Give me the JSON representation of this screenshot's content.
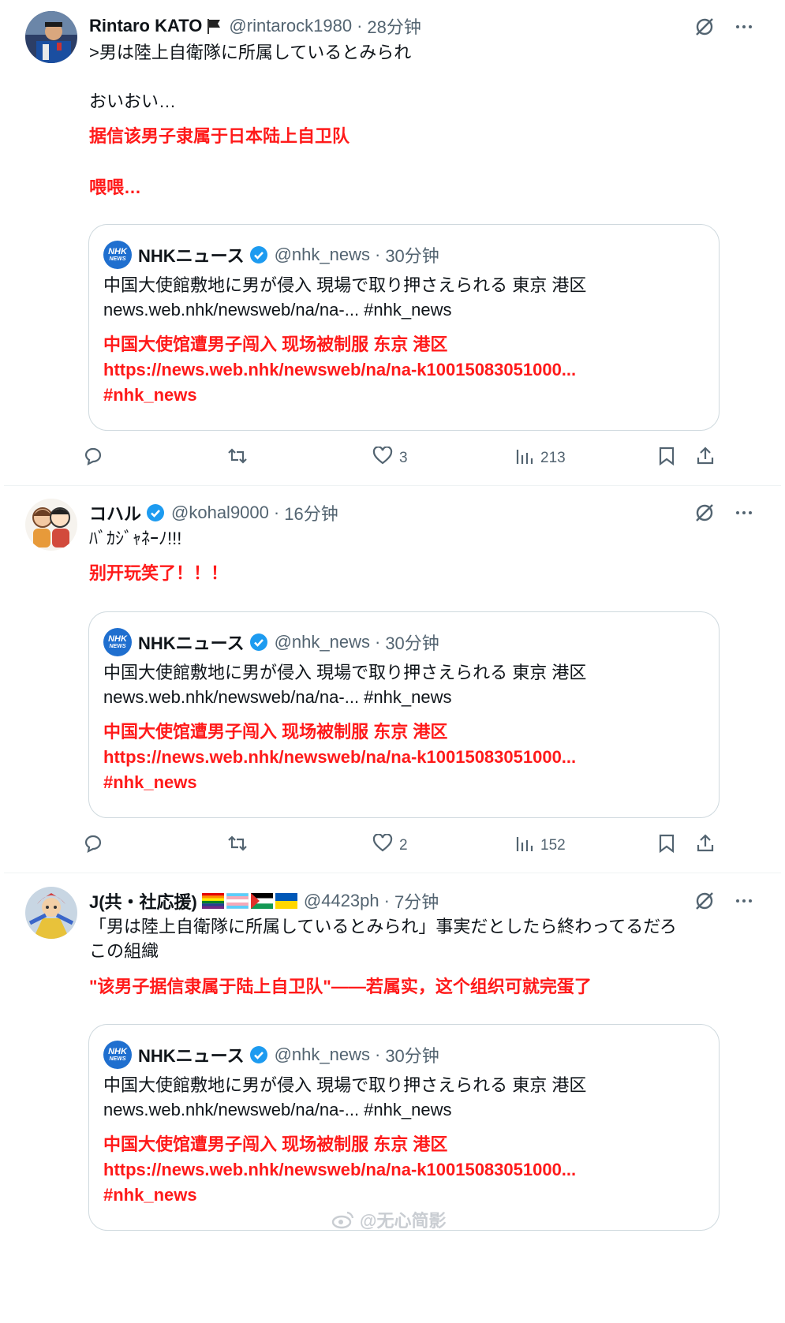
{
  "posts": [
    {
      "name": "Rintaro KATO",
      "name_flag": "🏴",
      "handle": "@rintarock1980",
      "time": "28分钟",
      "lines": [
        ">男は陸上自衛隊に所属しているとみられ",
        "おいおい…"
      ],
      "translations": [
        "据信该男子隶属于日本陆上自卫队",
        "喂喂…"
      ],
      "stats": {
        "replies": "",
        "reposts": "",
        "likes": "3",
        "views": "213"
      }
    },
    {
      "name": "コハル",
      "handle": "@kohal9000",
      "time": "16分钟",
      "lines": [
        "ﾊﾞｶｼﾞｬﾈｰﾉ!!!"
      ],
      "translations": [
        "别开玩笑了！！！"
      ],
      "stats": {
        "replies": "",
        "reposts": "",
        "likes": "2",
        "views": "152"
      }
    },
    {
      "name": "J(共・社応援)",
      "handle": "@4423ph",
      "time": "7分钟",
      "lines": [
        "「男は陸上自衛隊に所属しているとみられ」事実だとしたら終わってるだろ",
        "この組織"
      ],
      "translations": [
        "\"该男子据信隶属于陆上自卫队\"——若属实，这个组织可就完蛋了"
      ]
    }
  ],
  "quote": {
    "name": "NHKニュース",
    "handle": "@nhk_news",
    "time": "30分钟",
    "line1": "中国大使館敷地に男が侵入 現場で取り押さえられる 東京 港区",
    "line2": "news.web.nhk/newsweb/na/na-... #nhk_news",
    "tr1": "中国大使馆遭男子闯入 现场被制服 东京 港区",
    "tr2": "https://news.web.nhk/newsweb/na/na-k10015083051000...",
    "tr3": "#nhk_news",
    "logo_top": "NHK",
    "logo_bottom": "NEWS"
  },
  "meta_separator": "·",
  "watermark": "@无心简影",
  "colors": {
    "red": "#ff1a1a",
    "gray": "#536471",
    "blue": "#1d9bf0",
    "border": "#cfd9de"
  }
}
